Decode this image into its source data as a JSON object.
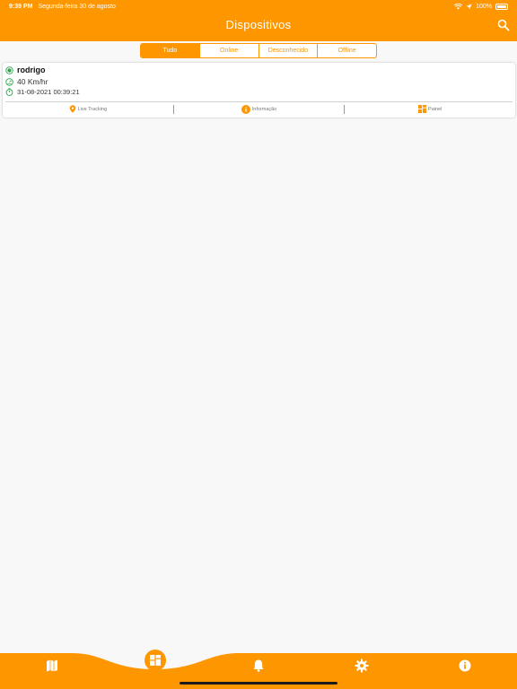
{
  "status_bar": {
    "time": "9:39 PM",
    "date": "Segunda-feira 30 de agosto",
    "battery": "100%"
  },
  "header": {
    "title": "Dispositivos",
    "search_icon": "search-icon"
  },
  "filter_tabs": [
    {
      "label": "Tudo",
      "active": true
    },
    {
      "label": "Online",
      "active": false
    },
    {
      "label": "Desconhecido",
      "active": false
    },
    {
      "label": "Offline",
      "active": false
    }
  ],
  "device": {
    "name": "rodrigo",
    "speed": "40 Km/hr",
    "timestamp": "31-08-2021 00:39:21",
    "status_color": "#2ea44f",
    "actions": [
      {
        "label": "Live Tracking",
        "icon": "location-pin-icon"
      },
      {
        "label": "Informação",
        "icon": "info-icon"
      },
      {
        "label": "Painel",
        "icon": "dashboard-icon"
      }
    ]
  },
  "bottom_nav": {
    "items": [
      "map-icon",
      "dashboard-icon",
      "bell-icon",
      "gear-icon",
      "info-icon"
    ],
    "active": "dashboard-icon"
  },
  "colors": {
    "accent": "#fe9600",
    "background": "#f8f8f8"
  }
}
